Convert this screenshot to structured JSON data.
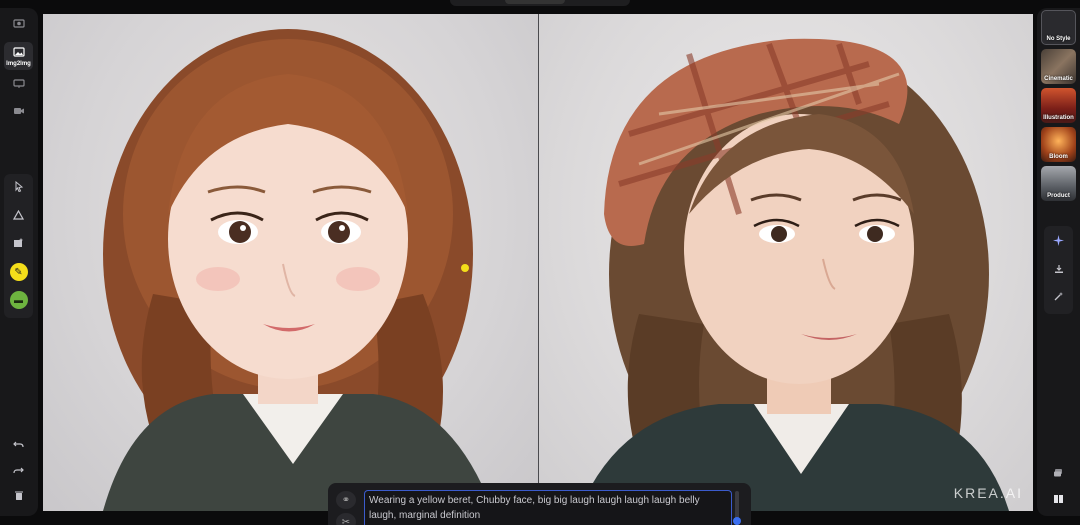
{
  "left_toolbar": {
    "modes": [
      {
        "icon": "camera-icon",
        "label": ""
      },
      {
        "icon": "image-icon",
        "label": "Img2Img"
      },
      {
        "icon": "monitor-icon",
        "label": ""
      },
      {
        "icon": "video-icon",
        "label": ""
      }
    ],
    "tools": [
      {
        "icon": "cursor-icon"
      },
      {
        "icon": "triangle-shape-icon"
      },
      {
        "icon": "image-add-icon"
      },
      {
        "icon": "brush-icon"
      },
      {
        "icon": "picture-icon"
      }
    ],
    "history": [
      {
        "icon": "undo-icon"
      },
      {
        "icon": "redo-icon"
      },
      {
        "icon": "trash-icon"
      }
    ]
  },
  "canvas": {
    "watermark": "KREA.AI"
  },
  "styles": {
    "items": [
      {
        "label": "No Style",
        "selected": true,
        "color": "#2a2a2e"
      },
      {
        "label": "Cinematic",
        "selected": false,
        "color": "#6b5a4a"
      },
      {
        "label": "Illustration",
        "selected": false,
        "color": "#8a2a22"
      },
      {
        "label": "Bloom",
        "selected": false,
        "color": "#b5561e"
      },
      {
        "label": "Product",
        "selected": false,
        "color": "#7b7f86"
      }
    ]
  },
  "right_tools": [
    {
      "icon": "sparkle-icon"
    },
    {
      "icon": "download-icon"
    },
    {
      "icon": "magic-wand-icon"
    }
  ],
  "right_bottom": [
    {
      "icon": "layers-icon"
    },
    {
      "icon": "split-view-icon"
    }
  ],
  "prompt": {
    "text": "Wearing a yellow beret,  Chubby face,  big big laugh laugh laugh laugh belly laugh,  marginal definition"
  }
}
